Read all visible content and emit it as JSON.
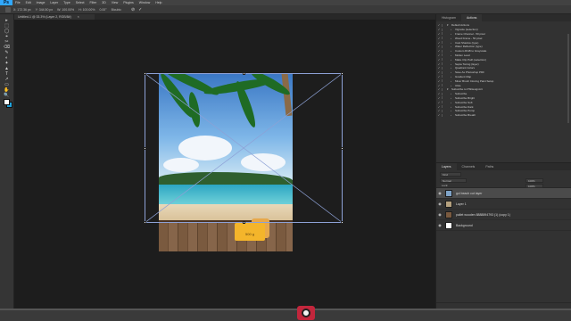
{
  "app": {
    "logo": "Ps CC"
  },
  "menu": [
    "File",
    "Edit",
    "Image",
    "Layer",
    "Type",
    "Select",
    "Filter",
    "3D",
    "View",
    "Plugins",
    "Window",
    "Help"
  ],
  "options": {
    "x": "X: 172.36 px",
    "y": "Y: 344.50 px",
    "w": "W: 100.00%",
    "h": "H: 100.00%",
    "angle": "0.00°",
    "interp": "Bicubic",
    "confirm": "✓",
    "cancel": "⊘"
  },
  "document": {
    "tab_title": "Untitled-1 @ 33.3% (Layer 2, RGB/8#)",
    "close": "×"
  },
  "tools": [
    "▸",
    "⬚",
    "◯",
    "⌖",
    "✂",
    "⌫",
    "✎",
    "◐",
    "✦",
    "▲",
    "T",
    "↗",
    "▭",
    "✋",
    "🔍"
  ],
  "actions_panel": {
    "tabs": [
      "Histogram",
      "Actions"
    ],
    "active_tab": "Actions",
    "rows": [
      {
        "label": "Default Actions",
        "folder": true
      },
      {
        "label": "Vignette (selection)"
      },
      {
        "label": "Frame Channel - 50 pixel"
      },
      {
        "label": "Wood Frame - 50 pixel"
      },
      {
        "label": "Cast Shadow (type)"
      },
      {
        "label": "Water Reflection (type)"
      },
      {
        "label": "Custom RGB to Grayscale"
      },
      {
        "label": "Molten Lead"
      },
      {
        "label": "Make Clip Path (selection)"
      },
      {
        "label": "Sepia Toning (layer)"
      },
      {
        "label": "Quadrant Colors"
      },
      {
        "label": "Save As Photoshop PDF"
      },
      {
        "label": "Gradient Map"
      },
      {
        "label": "Mixer Brush Cloning Paint Setup"
      },
      {
        "label": "Ultra"
      },
      {
        "label": "Subscribe to PSDesignArt",
        "folder": true
      },
      {
        "label": "Subscribe"
      },
      {
        "label": "Subscribe Bright"
      },
      {
        "label": "Subscribe Soft"
      },
      {
        "label": "Subscribe Dark"
      },
      {
        "label": "Subscribe Pump"
      },
      {
        "label": "Subscribe Breath"
      }
    ]
  },
  "layers_panel": {
    "tabs": [
      "Layers",
      "Channels",
      "Paths"
    ],
    "active_tab": "Layers",
    "kind": "Kind",
    "blend": "Normal",
    "opacity": "100%",
    "lock": "Lock:",
    "fill": "100%",
    "layers": [
      {
        "name": "gol beach cut layer",
        "selected": true,
        "thumb_color": "#7fa3c7"
      },
      {
        "name": "Layer 1",
        "selected": false,
        "thumb_color": "#b5a17f"
      },
      {
        "name": "pallet wooden 8888894793 (1) (copy 1)",
        "selected": false,
        "thumb_color": "#7a5a3f"
      },
      {
        "name": "Background",
        "selected": false,
        "thumb_color": "#ffffff"
      }
    ]
  },
  "photo": {
    "box_text": "500 g"
  },
  "colors": {
    "accent": "#31a8ff",
    "foreground": "#ffffff",
    "background": "#20a0d8",
    "record": "#c2263c"
  }
}
